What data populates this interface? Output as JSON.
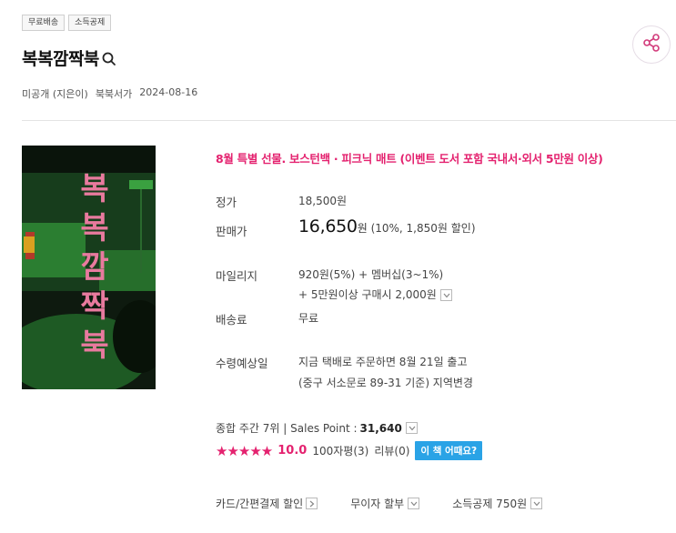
{
  "tags": [
    "무료배송",
    "소득공제"
  ],
  "title": "복복깜짝북",
  "meta": {
    "author": "미공개 (지은이)",
    "publisher": "북북서가",
    "date": "2024-08-16"
  },
  "cover": {
    "chars": [
      "복",
      "복",
      "깜",
      "짝",
      "북"
    ]
  },
  "event": "8월 특별 선물. 보스턴백 · 피크닉 매트 (이벤트 도서 포함 국내서·외서 5만원 이상)",
  "price": {
    "list_label": "정가",
    "list_value": "18,500원",
    "sale_label": "판매가",
    "sale_value": "16,650",
    "sale_unit": "원",
    "sale_note": "(10%, 1,850원 할인)"
  },
  "mileage": {
    "label": "마일리지",
    "line1": "920원(5%) + 멤버십(3~1%)",
    "line2": "+ 5만원이상 구매시 2,000원"
  },
  "shipping": {
    "label": "배송료",
    "value": "무료"
  },
  "delivery": {
    "label": "수령예상일",
    "line1": "지금 택배로 주문하면 8월 21일 출고",
    "line2": "(중구 서소문로 89-31 기준) 지역변경"
  },
  "rank": {
    "text": "종합 주간 7위  |  Sales Point :",
    "points": "31,640"
  },
  "rating": {
    "stars": "★★★★★",
    "score": "10.0",
    "reviews100": "100자평(3)",
    "reviews": "리뷰(0)",
    "ask_button": "이 책 어때요?"
  },
  "bottom": {
    "card": "카드/간편결제 할인",
    "installment": "무이자 할부",
    "deduction": "소득공제 750원"
  },
  "colors": {
    "accent": "#e4226f",
    "button": "#2aa3e6"
  }
}
